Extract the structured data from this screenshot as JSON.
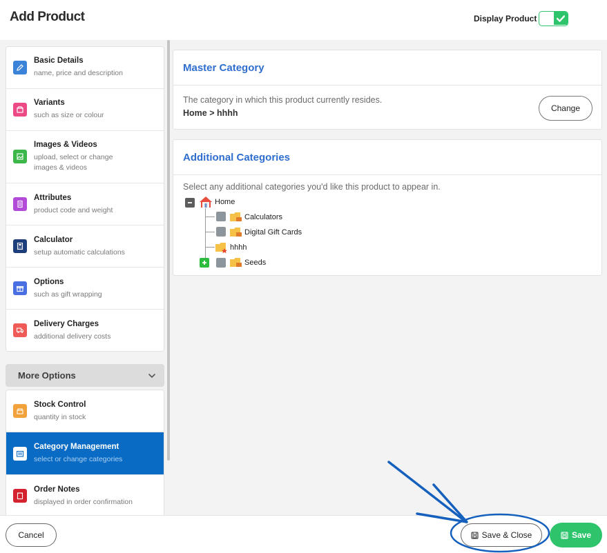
{
  "header": {
    "title": "Add Product",
    "display_label": "Display Product",
    "display_enabled": true
  },
  "sidebar": {
    "items": [
      {
        "title": "Basic Details",
        "subtitle": "name, price and description",
        "icon": "pencil-icon",
        "color": "#3b82d9"
      },
      {
        "title": "Variants",
        "subtitle": "such as size or colour",
        "icon": "box-icon",
        "color": "#ec4a87"
      },
      {
        "title": "Images & Videos",
        "subtitle": "upload, select or change images & videos",
        "icon": "image-icon",
        "color": "#3cb84a"
      },
      {
        "title": "Attributes",
        "subtitle": "product code and weight",
        "icon": "document-icon",
        "color": "#b14bd8"
      },
      {
        "title": "Calculator",
        "subtitle": "setup automatic calculations",
        "icon": "calculator-icon",
        "color": "#1e3d7b"
      },
      {
        "title": "Options",
        "subtitle": "such as gift wrapping",
        "icon": "gift-icon",
        "color": "#4a6fe3"
      },
      {
        "title": "Delivery Charges",
        "subtitle": "additional delivery costs",
        "icon": "truck-icon",
        "color": "#ef5b56"
      }
    ],
    "more_label": "More Options",
    "more_items": [
      {
        "title": "Stock Control",
        "subtitle": "quantity in stock",
        "icon": "stock-icon",
        "color": "#f2a23a"
      },
      {
        "title": "Category Management",
        "subtitle": "select or change categories",
        "icon": "category-icon",
        "color": "#ffffff",
        "active": true
      },
      {
        "title": "Order Notes",
        "subtitle": "displayed in order confirmation",
        "icon": "notes-icon",
        "color": "#d4232e"
      }
    ]
  },
  "master": {
    "title": "Master Category",
    "description": "The category in which this product currently resides.",
    "path": "Home > hhhh",
    "change_label": "Change"
  },
  "additional": {
    "title": "Additional Categories",
    "description": "Select any additional categories you'd like this product to appear in.",
    "tree": {
      "root": "Home",
      "children": [
        "Calculators",
        "Digital Gift Cards",
        "hhhh",
        "Seeds"
      ]
    }
  },
  "footer": {
    "cancel_label": "Cancel",
    "save_close_label": "Save & Close",
    "save_label": "Save"
  },
  "colors": {
    "accent_blue": "#2f6ecf",
    "active_nav": "#0a6bc4",
    "green": "#2ec46c",
    "annotation": "#1560bd"
  }
}
